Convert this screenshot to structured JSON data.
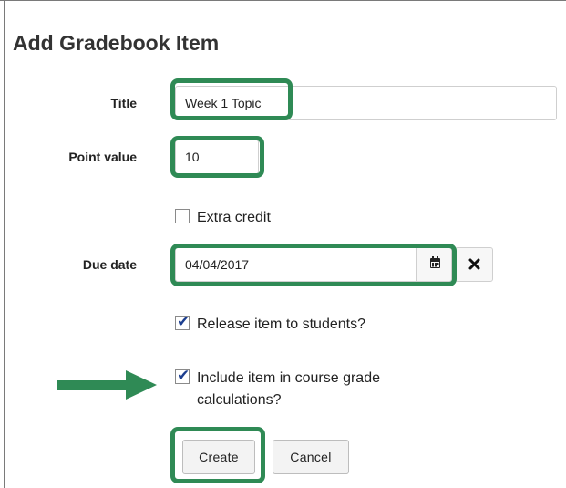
{
  "form": {
    "title": "Add Gradebook Item",
    "fields": {
      "title_label": "Title",
      "title_value": "Week 1 Topic",
      "points_label": "Point value",
      "points_value": "10",
      "extra_credit_label": "Extra credit",
      "extra_credit_checked": false,
      "due_label": "Due date",
      "due_value": "04/04/2017",
      "release_label": "Release item to students?",
      "release_checked": true,
      "include_label_line1": "Include item in course grade",
      "include_label_line2": "calculations?",
      "include_checked": true
    },
    "buttons": {
      "create": "Create",
      "cancel": "Cancel"
    }
  },
  "annotation": {
    "highlight_color": "#2f8a55",
    "arrow_color": "#2f8a55"
  },
  "icons": {
    "calendar": "calendar-icon",
    "clear": "clear-date-icon",
    "check": "checkmark-icon"
  }
}
